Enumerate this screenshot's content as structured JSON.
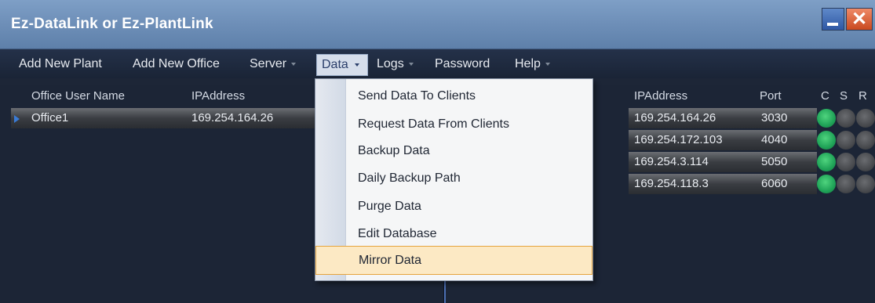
{
  "window": {
    "title": "Ez-DataLink or Ez-PlantLink",
    "minimize_label": "",
    "close_label": "✕"
  },
  "menubar": {
    "items": [
      {
        "label": "Add New Plant",
        "has_dropdown": false
      },
      {
        "label": "Add New Office",
        "has_dropdown": false
      },
      {
        "label": "Server",
        "has_dropdown": true
      },
      {
        "label": "Data",
        "has_dropdown": true,
        "active": true
      },
      {
        "label": "Logs",
        "has_dropdown": true
      },
      {
        "label": "Password",
        "has_dropdown": false
      },
      {
        "label": "Help",
        "has_dropdown": true
      }
    ]
  },
  "data_menu": {
    "items": [
      {
        "label": "Send Data To Clients"
      },
      {
        "label": "Request Data From Clients"
      },
      {
        "label": "Backup Data"
      },
      {
        "label": "Daily Backup Path"
      },
      {
        "label": "Purge Data"
      },
      {
        "label": "Edit Database"
      },
      {
        "label": "Mirror Data",
        "highlighted": true
      }
    ]
  },
  "office_table": {
    "headers": {
      "name": "Office User Name",
      "ip": "IPAddress"
    },
    "rows": [
      {
        "name": "Office1",
        "ip": "169.254.164.26"
      }
    ]
  },
  "plant_table": {
    "headers": {
      "ip": "IPAddress",
      "port": "Port",
      "c": "C",
      "s": "S",
      "r": "R"
    },
    "rows": [
      {
        "ip": "169.254.164.26",
        "port": "3030",
        "c": "green",
        "s": "gray"
      },
      {
        "ip": "169.254.172.103",
        "port": "4040",
        "c": "green",
        "s": "gray"
      },
      {
        "ip": "169.254.3.114",
        "port": "5050",
        "c": "green",
        "s": "gray"
      },
      {
        "ip": "169.254.118.3",
        "port": "6060",
        "c": "green",
        "s": "gray"
      }
    ]
  },
  "colors": {
    "titlebar": "#6f90b9",
    "menubar": "#1f2a3e",
    "highlight": "#fce9c4",
    "status_connected": "#1fa257",
    "status_idle": "#45474b"
  }
}
